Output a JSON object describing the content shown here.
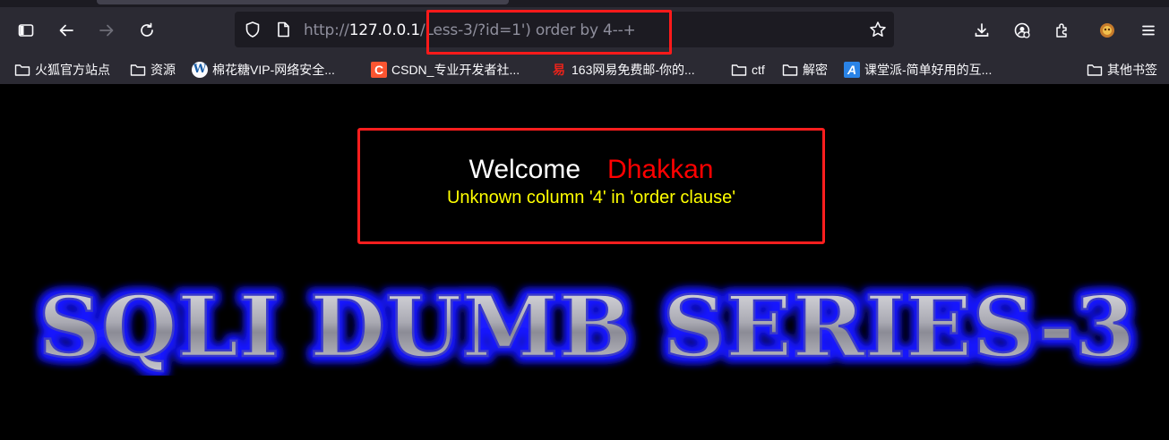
{
  "browser": {
    "url": {
      "protocol": "http://",
      "host": "127.0.0.1",
      "path": "/Less-3/?id=1') order by 4--+"
    },
    "toolbar_icons": [
      "sidebar-icon",
      "back-icon",
      "forward-icon",
      "reload-icon",
      "shield-icon",
      "page-icon",
      "star-icon",
      "download-icon",
      "account-icon",
      "extensions-icon",
      "profile-avatar-icon",
      "menu-icon"
    ]
  },
  "bookmarks": [
    {
      "label": "火狐官方站点",
      "icon": "folder-icon"
    },
    {
      "label": "资源",
      "icon": "folder-icon"
    },
    {
      "label": "棉花糖VIP-网络安全...",
      "icon": "wordpress-icon"
    },
    {
      "label": "CSDN_专业开发者社...",
      "icon": "csdn-icon"
    },
    {
      "label": "163网易免费邮-你的...",
      "icon": "netease-icon"
    },
    {
      "label": "ctf",
      "icon": "folder-icon"
    },
    {
      "label": "解密",
      "icon": "folder-icon"
    },
    {
      "label": "课堂派-简单好用的互...",
      "icon": "ketangpai-icon"
    },
    {
      "label": "其他书签",
      "icon": "folder-icon"
    }
  ],
  "page": {
    "welcome": "Welcome",
    "name": "Dhakkan",
    "error": "Unknown column '4' in 'order clause'",
    "banner": "SQLI DUMB SERIES-3"
  },
  "colors": {
    "highlight": "#ff1a1a",
    "welcome": "#ffffff",
    "name": "#ff0000",
    "error": "#ffff00",
    "banner_glow": "#1a1aff"
  }
}
